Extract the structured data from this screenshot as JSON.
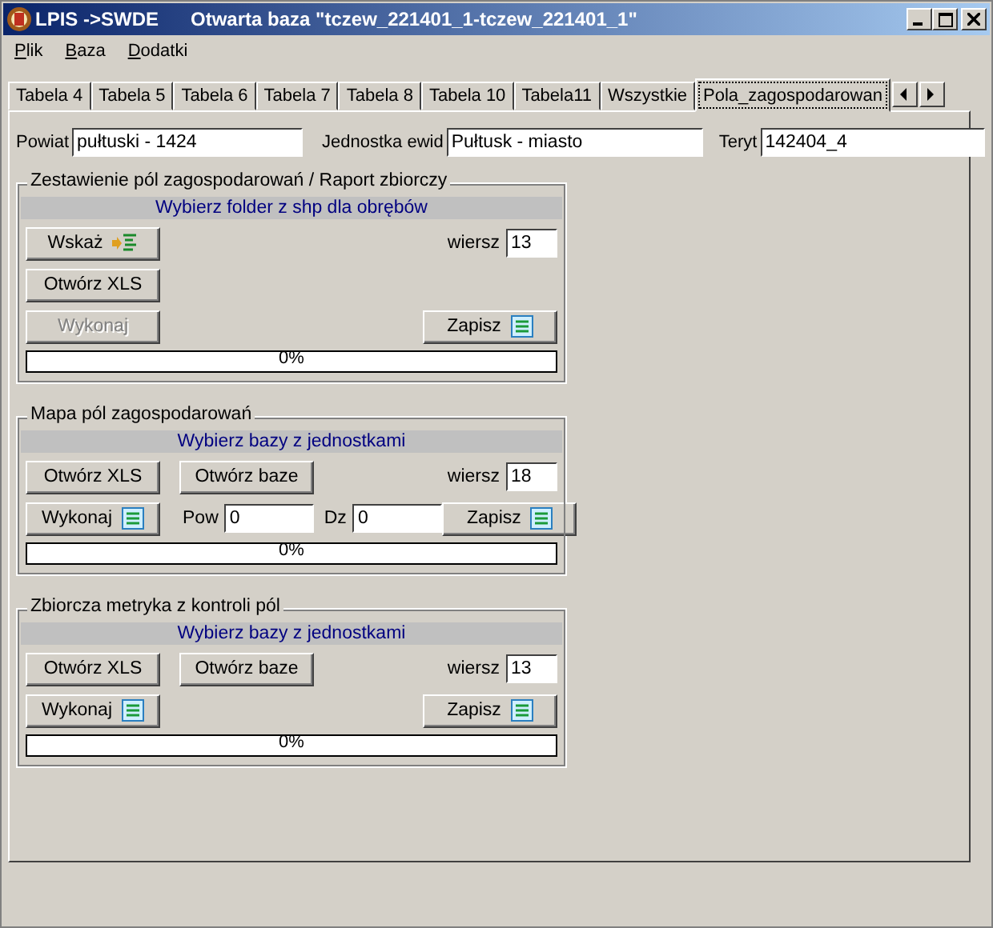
{
  "window": {
    "app_name": "LPIS ->SWDE",
    "title": "Otwarta baza \"tczew_221401_1-tczew_221401_1\""
  },
  "menu": [
    {
      "label": "Plik"
    },
    {
      "label": "Baza"
    },
    {
      "label": "Dodatki"
    }
  ],
  "tabs": [
    {
      "label": "Tabela 4",
      "selected": false
    },
    {
      "label": "Tabela 5",
      "selected": false
    },
    {
      "label": "Tabela 6",
      "selected": false
    },
    {
      "label": "Tabela 7",
      "selected": false
    },
    {
      "label": "Tabela 8",
      "selected": false
    },
    {
      "label": "Tabela 10",
      "selected": false
    },
    {
      "label": "Tabela11",
      "selected": false
    },
    {
      "label": "Wszystkie",
      "selected": false
    },
    {
      "label": "Pola_zagospodarowan",
      "selected": true
    }
  ],
  "fields": [
    {
      "label": "Powiat",
      "value": "pułtuski - 1424"
    },
    {
      "label": "Jednostka ewid",
      "value": "Pułtusk - miasto"
    },
    {
      "label": "Teryt",
      "value": "142404_4"
    }
  ],
  "groups": [
    {
      "title": "Zestawienie pól zagospodarowań / Raport zbiorczy",
      "hint": "Wybierz folder z shp dla obrębów",
      "rows": [
        {
          "left": [
            {
              "kind": "pointer-button",
              "label": "Wskaż",
              "disabled": false
            }
          ],
          "right": [
            {
              "kind": "field",
              "label": "wiersz",
              "value": "13"
            }
          ]
        },
        {
          "left": [
            {
              "kind": "button",
              "label": "Otwórz XLS",
              "disabled": false
            }
          ],
          "right": []
        },
        {
          "left": [
            {
              "kind": "button",
              "label": "Wykonaj",
              "disabled": true
            }
          ],
          "right": [
            {
              "kind": "list-button",
              "label": "Zapisz",
              "disabled": false
            }
          ]
        }
      ],
      "progress": {
        "level": 0,
        "reading": "0%"
      }
    },
    {
      "title": "Mapa pól zagospodarowań",
      "hint": "Wybierz bazy z jednostkami",
      "rows": [
        {
          "left": [
            {
              "kind": "button",
              "label": "Otwórz XLS",
              "disabled": false
            },
            {
              "kind": "button",
              "label": "Otwórz baze",
              "disabled": false
            }
          ],
          "right": [
            {
              "kind": "field",
              "label": "wiersz",
              "value": "18"
            }
          ]
        },
        {
          "left": [
            {
              "kind": "list-button",
              "label": "Wykonaj",
              "disabled": false
            },
            {
              "kind": "field",
              "label": "Pow",
              "value": "0"
            },
            {
              "kind": "field",
              "label": "Dz",
              "value": "0"
            }
          ],
          "right": [
            {
              "kind": "list-button",
              "label": "Zapisz",
              "disabled": false
            }
          ]
        }
      ],
      "progress": {
        "level": 0,
        "reading": "0%"
      }
    },
    {
      "title": "Zbiorcza metryka z kontroli pól",
      "hint": "Wybierz bazy z jednostkami",
      "rows": [
        {
          "left": [
            {
              "kind": "button",
              "label": "Otwórz XLS",
              "disabled": false
            },
            {
              "kind": "button",
              "label": "Otwórz baze",
              "disabled": false
            }
          ],
          "right": [
            {
              "kind": "field",
              "label": "wiersz",
              "value": "13"
            }
          ]
        },
        {
          "left": [
            {
              "kind": "list-button",
              "label": "Wykonaj",
              "disabled": false
            }
          ],
          "right": [
            {
              "kind": "list-button",
              "label": "Zapisz",
              "disabled": false
            }
          ]
        }
      ],
      "progress": {
        "level": 0,
        "reading": "0%"
      }
    }
  ]
}
